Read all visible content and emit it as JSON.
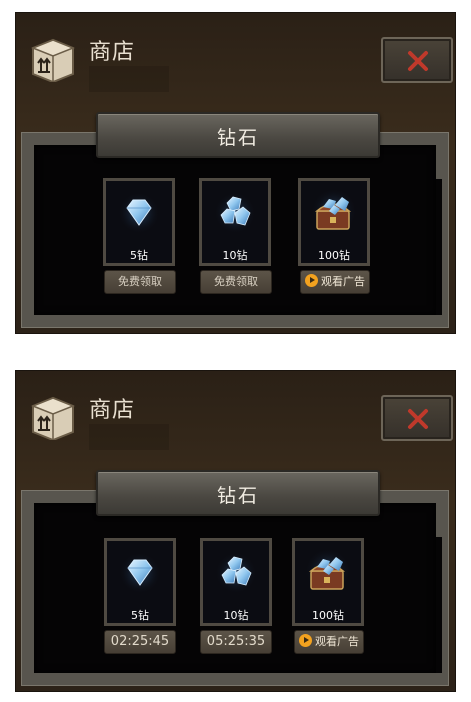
{
  "screens": [
    {
      "header": {
        "title": "商店"
      },
      "section": {
        "title": "钻石"
      },
      "items": [
        {
          "amount_label": "5钻",
          "action_label": "免费领取",
          "action_type": "free"
        },
        {
          "amount_label": "10钻",
          "action_label": "免费领取",
          "action_type": "free"
        },
        {
          "amount_label": "100钻",
          "action_label": "观看广告",
          "action_type": "ad"
        }
      ]
    },
    {
      "header": {
        "title": "商店"
      },
      "section": {
        "title": "钻石"
      },
      "items": [
        {
          "amount_label": "5钻",
          "action_label": "02:25:45",
          "action_type": "timer"
        },
        {
          "amount_label": "10钻",
          "action_label": "05:25:35",
          "action_type": "timer"
        },
        {
          "amount_label": "100钻",
          "action_label": "观看广告",
          "action_type": "ad"
        }
      ]
    }
  ],
  "colors": {
    "close_x": "#c0392b",
    "play_icon": "#f3a21f",
    "panel_bg": "#2a2016"
  }
}
